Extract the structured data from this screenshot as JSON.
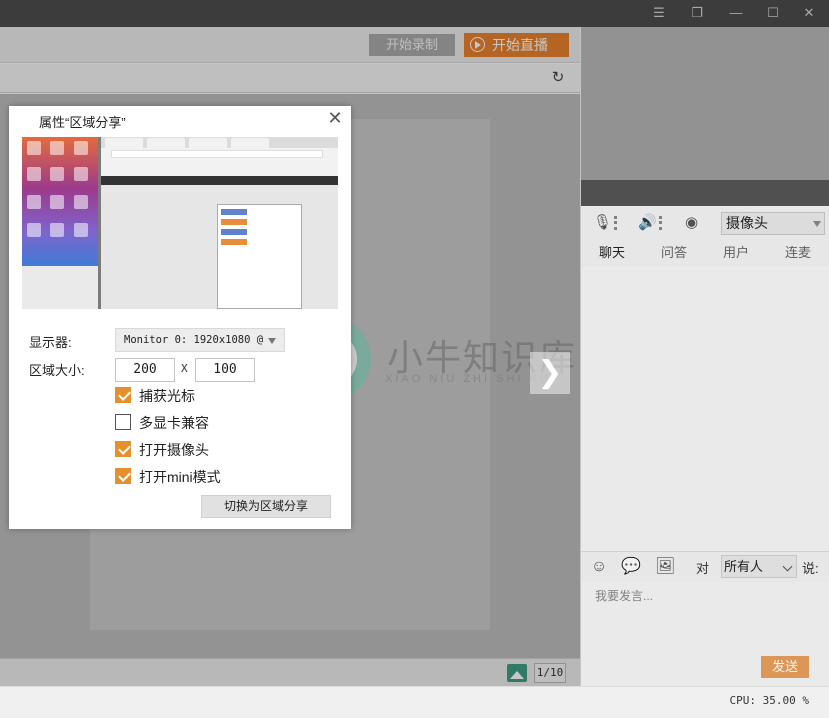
{
  "header": {
    "record_label": "开始录制",
    "live_label": "开始直播"
  },
  "footer": {
    "page_indicator": "1/10",
    "cpu": "CPU: 35.00 %"
  },
  "devices": {
    "camera_select": "摄像头"
  },
  "tabs": [
    {
      "label": "聊天"
    },
    {
      "label": "问答"
    },
    {
      "label": "用户"
    },
    {
      "label": "连麦"
    }
  ],
  "chat": {
    "to_label": "对",
    "recipient": "所有人",
    "say_label": "说:",
    "placeholder": "我要发言...",
    "send_label": "发送"
  },
  "watermark": {
    "brand_cn": "小牛知识库",
    "brand_en": "XIAO NIU ZHI SHI KU"
  },
  "dialog": {
    "title": "属性“区域分享”",
    "monitor_label": "显示器:",
    "monitor_value": "Monitor 0: 1920x1080 @",
    "area_label": "区域大小:",
    "width": "200",
    "separator": "X",
    "height": "100",
    "options": [
      {
        "label": "捕获光标",
        "checked": true
      },
      {
        "label": "多显卡兼容",
        "checked": false
      },
      {
        "label": "打开摄像头",
        "checked": true
      },
      {
        "label": "打开mini模式",
        "checked": true
      }
    ],
    "switch_label": "切换为区域分享"
  },
  "icons": {
    "minimize": "minimize-icon",
    "restore": "restore-icon",
    "maximize": "maximize-icon",
    "close": "close-icon"
  },
  "colors": {
    "accent": "#e8822d",
    "checkbox": "#e5902d",
    "send": "#e8a05c",
    "teal": "#3e9e84"
  }
}
